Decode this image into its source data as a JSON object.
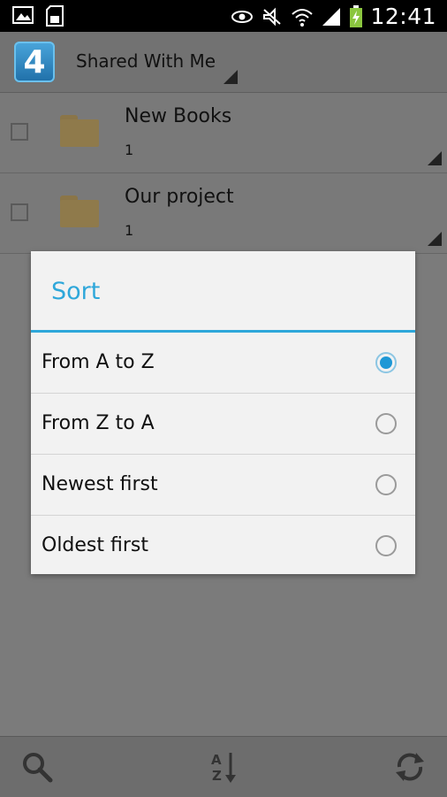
{
  "status_bar": {
    "time": "12:41",
    "icons": [
      "image-icon",
      "sd-card-icon",
      "eye-icon",
      "mute-icon",
      "wifi-icon",
      "signal-icon",
      "battery-charging-icon"
    ]
  },
  "action_bar": {
    "logo_text": "4",
    "title": "Shared With Me"
  },
  "list": [
    {
      "name": "New Books",
      "count": "1"
    },
    {
      "name": "Our project",
      "count": "1"
    }
  ],
  "dialog": {
    "title": "Sort",
    "options": [
      {
        "label": "From A to Z",
        "selected": true
      },
      {
        "label": "From Z to A",
        "selected": false
      },
      {
        "label": "Newest first",
        "selected": false
      },
      {
        "label": "Oldest first",
        "selected": false
      }
    ]
  },
  "bottom_bar": {
    "icons": [
      "search-icon",
      "sort-az-icon",
      "refresh-icon"
    ]
  },
  "colors": {
    "accent": "#2ea7da",
    "radio_selected": "#1e98d6"
  }
}
